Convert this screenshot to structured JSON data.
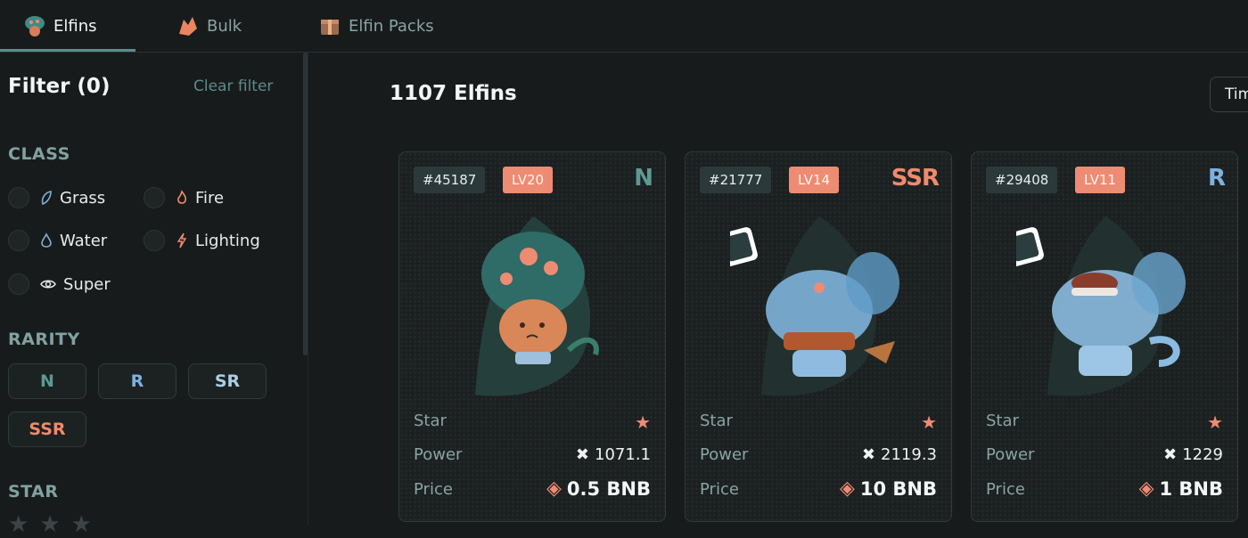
{
  "nav": {
    "tabs": [
      {
        "label": "Elfins",
        "icon": "elfin-mushroom-icon"
      },
      {
        "label": "Bulk",
        "icon": "bulk-leaf-icon"
      },
      {
        "label": "Elfin Packs",
        "icon": "pack-box-icon"
      }
    ],
    "active_tab": "Elfins"
  },
  "sidebar": {
    "filter_title": "Filter (0)",
    "clear_filter": "Clear filter",
    "class": {
      "title": "CLASS",
      "items": [
        {
          "label": "Grass",
          "icon": "leaf-icon"
        },
        {
          "label": "Fire",
          "icon": "flame-icon"
        },
        {
          "label": "Water",
          "icon": "droplet-icon"
        },
        {
          "label": "Lighting",
          "icon": "lightning-icon"
        },
        {
          "label": "Super",
          "icon": "eye-icon"
        }
      ]
    },
    "rarity": {
      "title": "RARITY",
      "items": [
        "N",
        "R",
        "SR",
        "SSR"
      ]
    },
    "star": {
      "title": "STAR"
    }
  },
  "main": {
    "count_title": "1107 Elfins",
    "sort_label": "Tim",
    "cards": [
      {
        "id": "#45187",
        "level": "LV20",
        "rarity": "N",
        "star_label": "Star",
        "power_label": "Power",
        "power": "1071.1",
        "price_label": "Price",
        "price": "0.5 BNB",
        "stars": 1
      },
      {
        "id": "#21777",
        "level": "LV14",
        "rarity": "SSR",
        "star_label": "Star",
        "power_label": "Power",
        "power": "2119.3",
        "price_label": "Price",
        "price": "10 BNB",
        "stars": 1
      },
      {
        "id": "#29408",
        "level": "LV11",
        "rarity": "R",
        "star_label": "Star",
        "power_label": "Power",
        "power": "1229",
        "price_label": "Price",
        "price": "1 BNB",
        "stars": 1
      }
    ]
  },
  "colors": {
    "accent": "#5b8e8c",
    "badge_orange": "#ee8b73",
    "rarity_N": "#5d9a94",
    "rarity_R": "#7fb1e0",
    "rarity_SR": "#a9cfe6",
    "rarity_SSR": "#ef8a6c"
  }
}
